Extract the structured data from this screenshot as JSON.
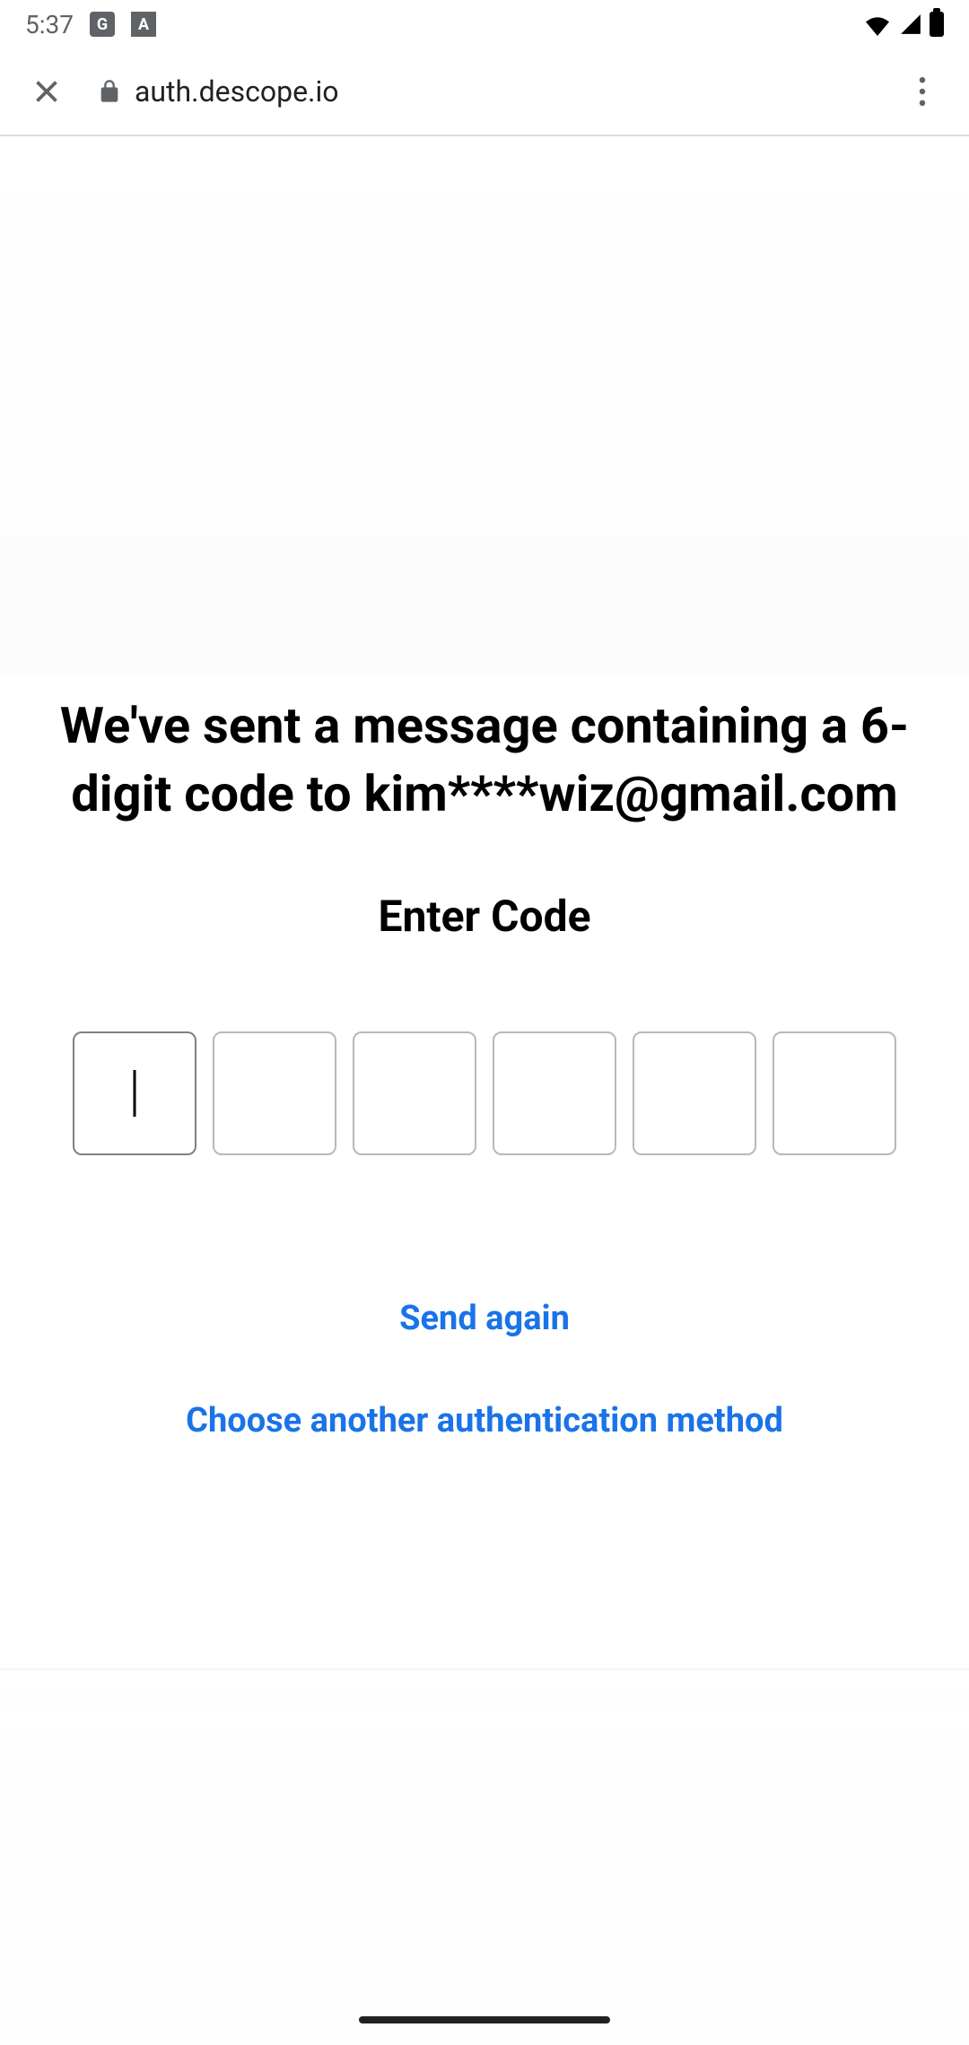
{
  "status_bar": {
    "time": "5:37",
    "icon_g": "G",
    "icon_a": "A"
  },
  "browser": {
    "url": "auth.descope.io"
  },
  "content": {
    "message": "We've sent a message containing a 6-digit code to kim****wiz@gmail.com",
    "enter_code_label": "Enter Code",
    "code_digits": [
      "",
      "",
      "",
      "",
      "",
      ""
    ],
    "send_again_label": "Send again",
    "choose_another_label": "Choose another authentication method"
  },
  "colors": {
    "link": "#1a73e8",
    "text": "#000000",
    "border": "#b8b8b8"
  }
}
